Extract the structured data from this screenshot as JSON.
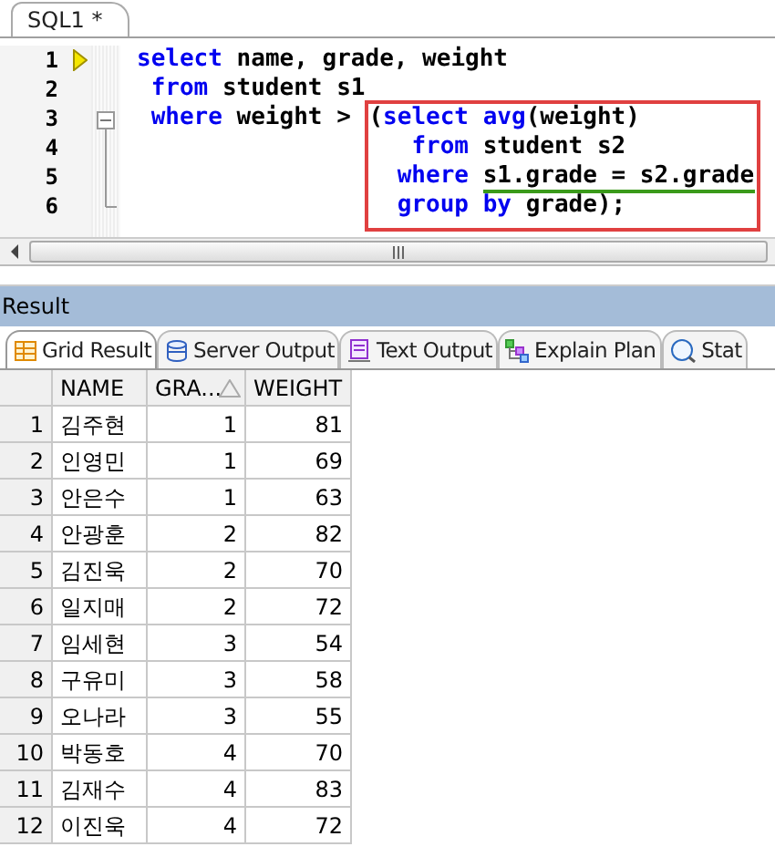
{
  "editor_tab": {
    "title": "SQL1 *",
    "selected": true
  },
  "editor": {
    "line_numbers": [
      "1",
      "2",
      "3",
      "4",
      "5",
      "6"
    ],
    "lines": [
      [
        {
          "kind": "keyword",
          "text": "select "
        },
        {
          "kind": "plain",
          "text": "name, grade, weight"
        }
      ],
      [
        {
          "kind": "keyword",
          "text": "from "
        },
        {
          "kind": "plain",
          "text": "student s1"
        }
      ],
      [
        {
          "kind": "keyword",
          "text": "where "
        },
        {
          "kind": "plain",
          "text": "weight >"
        }
      ]
    ],
    "boxed_lines": [
      [
        {
          "kind": "plain",
          "text": "("
        },
        {
          "kind": "keyword",
          "text": "select "
        },
        {
          "kind": "keyword",
          "text": "avg"
        },
        {
          "kind": "plain",
          "text": "(weight)"
        }
      ],
      [
        {
          "kind": "keyword",
          "text": "from "
        },
        {
          "kind": "plain",
          "text": "student s2"
        }
      ],
      [
        {
          "kind": "keyword",
          "text": "where "
        },
        {
          "kind": "underlined",
          "text": "s1.grade = s2.grade"
        }
      ],
      [
        {
          "kind": "keyword",
          "text": "group by "
        },
        {
          "kind": "plain",
          "text": "grade);"
        }
      ]
    ]
  },
  "result_panel": {
    "title": "Result",
    "tabs": [
      {
        "label": "Grid Result",
        "selected": true
      },
      {
        "label": "Server Output",
        "selected": false
      },
      {
        "label": "Text Output",
        "selected": false
      },
      {
        "label": "Explain Plan",
        "selected": false
      },
      {
        "label": "Stat",
        "selected": false
      }
    ],
    "table": {
      "columns": [
        {
          "label": "NAME",
          "sorted": false
        },
        {
          "label": "GRA...",
          "sorted": true
        },
        {
          "label": "WEIGHT",
          "sorted": false
        }
      ],
      "rows": [
        {
          "num": "1",
          "cells": [
            "김주현",
            "1",
            "81"
          ]
        },
        {
          "num": "2",
          "cells": [
            "인영민",
            "1",
            "69"
          ]
        },
        {
          "num": "3",
          "cells": [
            "안은수",
            "1",
            "63"
          ]
        },
        {
          "num": "4",
          "cells": [
            "안광훈",
            "2",
            "82"
          ]
        },
        {
          "num": "5",
          "cells": [
            "김진욱",
            "2",
            "70"
          ]
        },
        {
          "num": "6",
          "cells": [
            "일지매",
            "2",
            "72"
          ]
        },
        {
          "num": "7",
          "cells": [
            "임세현",
            "3",
            "54"
          ]
        },
        {
          "num": "8",
          "cells": [
            "구유미",
            "3",
            "58"
          ]
        },
        {
          "num": "9",
          "cells": [
            "오나라",
            "3",
            "55"
          ]
        },
        {
          "num": "10",
          "cells": [
            "박동호",
            "4",
            "70"
          ]
        },
        {
          "num": "11",
          "cells": [
            "김재수",
            "4",
            "83"
          ]
        },
        {
          "num": "12",
          "cells": [
            "이진욱",
            "4",
            "72"
          ]
        }
      ]
    }
  }
}
